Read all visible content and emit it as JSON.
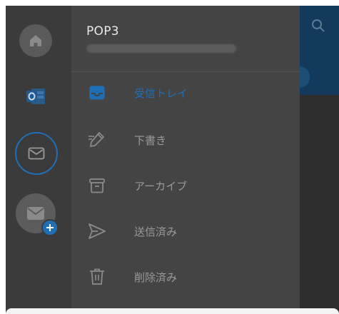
{
  "account": {
    "name": "POP3",
    "email_redacted": true
  },
  "folders": [
    {
      "label": "受信トレイ",
      "icon": "inbox-icon",
      "active": true
    },
    {
      "label": "下書き",
      "icon": "pencil-icon",
      "active": false
    },
    {
      "label": "アーカイブ",
      "icon": "archive-icon",
      "active": false
    },
    {
      "label": "送信済み",
      "icon": "send-icon",
      "active": false
    },
    {
      "label": "削除済み",
      "icon": "trash-icon",
      "active": false
    }
  ],
  "rail": {
    "items": [
      "home-icon",
      "outlook-icon",
      "mail-icon",
      "add-account-icon"
    ]
  },
  "colors": {
    "accent": "#1f6fb8",
    "drawer_bg": "#444444",
    "rail_bg": "#3b3b3b",
    "text_muted": "#9a9a9a"
  }
}
